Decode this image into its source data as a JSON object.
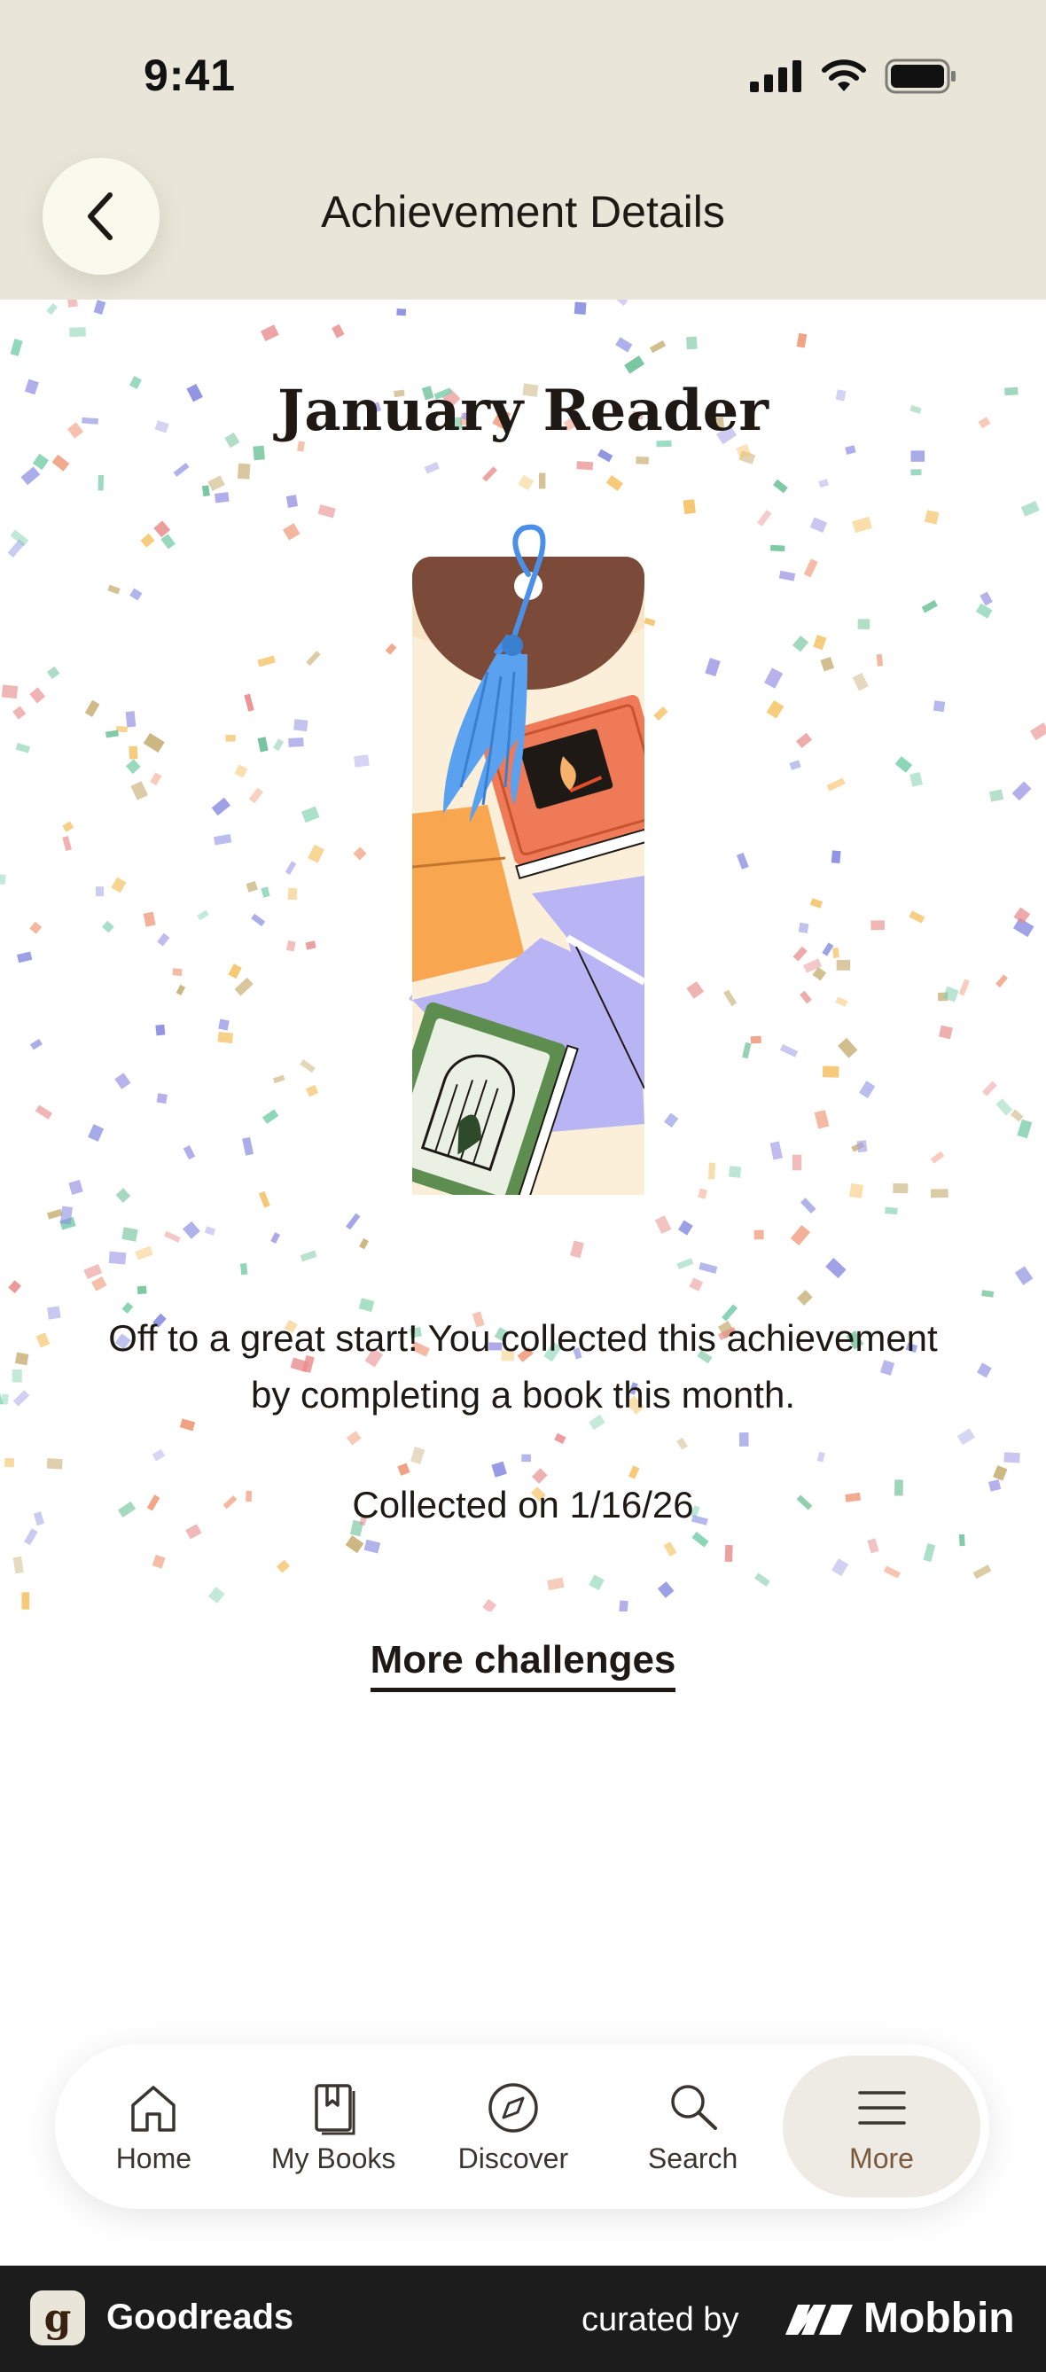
{
  "status_bar": {
    "time": "9:41"
  },
  "header": {
    "title": "Achievement Details"
  },
  "achievement": {
    "title": "January Reader",
    "description": "Off to a great start! You collected this achievement by completing a book this month.",
    "collected": "Collected on 1/16/26",
    "more_challenges": "More challenges"
  },
  "tabs": [
    {
      "label": "Home",
      "icon": "home-icon",
      "active": false
    },
    {
      "label": "My Books",
      "icon": "my-books-icon",
      "active": false
    },
    {
      "label": "Discover",
      "icon": "compass-icon",
      "active": false
    },
    {
      "label": "Search",
      "icon": "search-icon",
      "active": false
    },
    {
      "label": "More",
      "icon": "menu-icon",
      "active": true
    }
  ],
  "footer": {
    "app_name": "Goodreads",
    "curated_by": "curated by",
    "brand": "Mobbin"
  },
  "colors": {
    "header_bg": "#e9e5d8",
    "text": "#1e1915",
    "active_tab_bg": "#eeeae4",
    "active_tab_text": "#7a5a3c",
    "footer_bg": "#1c1c1c"
  }
}
